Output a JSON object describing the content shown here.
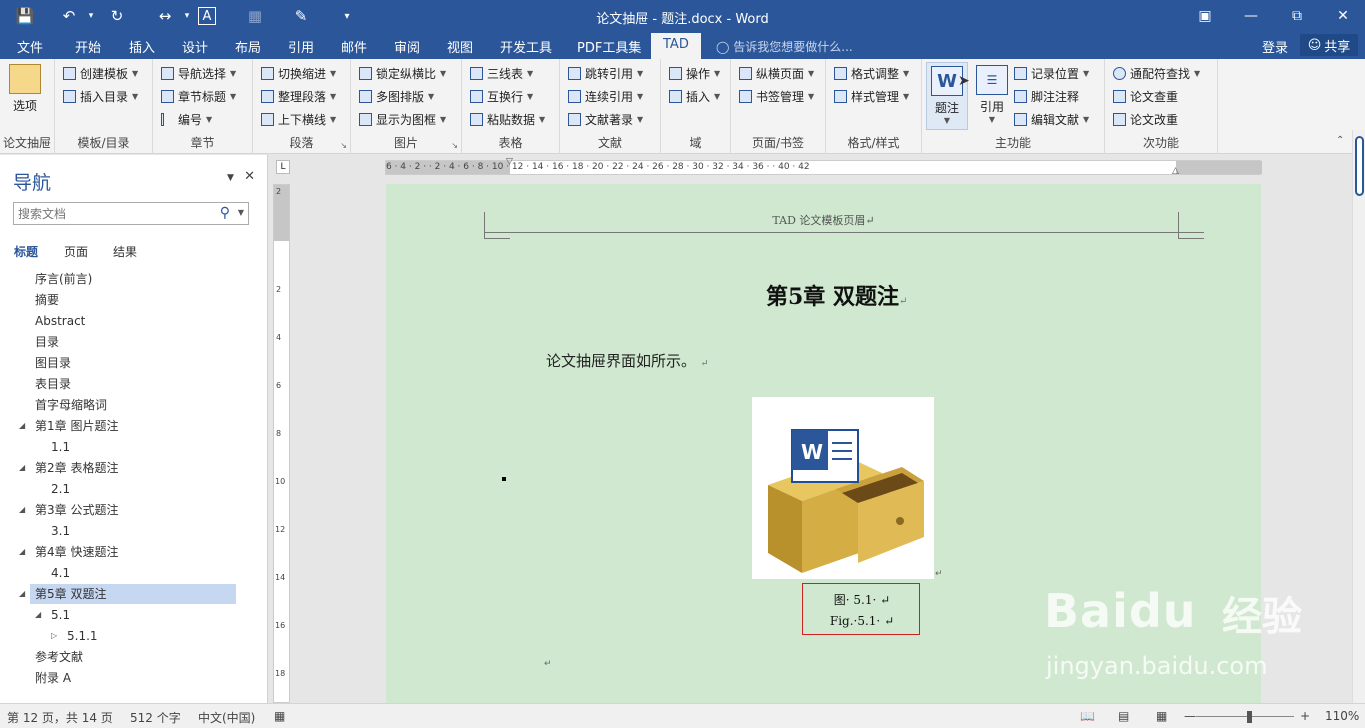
{
  "window": {
    "title": "论文抽屉 - 题注.docx - Word",
    "controls": [
      "restore-ribbon",
      "minimize",
      "restore",
      "close"
    ]
  },
  "tabs": [
    {
      "label": "文件"
    },
    {
      "label": "开始"
    },
    {
      "label": "插入"
    },
    {
      "label": "设计"
    },
    {
      "label": "布局"
    },
    {
      "label": "引用"
    },
    {
      "label": "邮件"
    },
    {
      "label": "审阅"
    },
    {
      "label": "视图"
    },
    {
      "label": "开发工具"
    },
    {
      "label": "PDF工具集"
    },
    {
      "label": "TAD"
    }
  ],
  "tell_me": "告诉我您想要做什么...",
  "account": {
    "login": "登录",
    "share": "共享"
  },
  "ribbon": {
    "groups": {
      "g1": {
        "label": "论文抽屉",
        "big": "选项"
      },
      "g2": {
        "label": "模板/目录",
        "items": [
          "创建模板",
          "插入目录"
        ]
      },
      "g3": {
        "label": "章节",
        "items": [
          "导航选择",
          "章节标题",
          "编号"
        ]
      },
      "g4": {
        "label": "段落",
        "items": [
          "切换缩进",
          "整理段落",
          "上下横线"
        ]
      },
      "g5": {
        "label": "图片",
        "items": [
          "锁定纵横比",
          "多图排版",
          "显示为图框"
        ]
      },
      "g6": {
        "label": "表格",
        "items": [
          "三线表",
          "互换行",
          "粘贴数据"
        ]
      },
      "g7": {
        "label": "文献",
        "items": [
          "跳转引用",
          "连续引用",
          "文献著录"
        ]
      },
      "g8": {
        "label": "域",
        "items": [
          "操作",
          "插入"
        ]
      },
      "g9": {
        "label": "页面/书签",
        "items": [
          "纵横页面",
          "书签管理"
        ]
      },
      "g10": {
        "label": "格式/样式",
        "items": [
          "格式调整",
          "样式管理"
        ]
      },
      "g11": {
        "label": "主功能",
        "big1": "题注",
        "big2": "引用",
        "items": [
          "记录位置",
          "脚注注释",
          "编辑文献"
        ]
      },
      "g12": {
        "label": "次功能",
        "items": [
          "通配符查找",
          "论文查重",
          "论文改重"
        ]
      }
    }
  },
  "nav": {
    "title": "导航",
    "search_placeholder": "搜索文档",
    "tabs": [
      "标题",
      "页面",
      "结果"
    ],
    "items": [
      {
        "label": "序言(前言)"
      },
      {
        "label": "摘要"
      },
      {
        "label": "Abstract"
      },
      {
        "label": "目录"
      },
      {
        "label": "图目录"
      },
      {
        "label": "表目录"
      },
      {
        "label": "首字母缩略词"
      },
      {
        "label": "第1章 图片题注"
      },
      {
        "label": "1.1"
      },
      {
        "label": "第2章 表格题注"
      },
      {
        "label": "2.1"
      },
      {
        "label": "第3章 公式题注"
      },
      {
        "label": "3.1"
      },
      {
        "label": "第4章 快速题注"
      },
      {
        "label": "4.1"
      },
      {
        "label": "第5章 双题注"
      },
      {
        "label": "5.1"
      },
      {
        "label": "5.1.1"
      },
      {
        "label": "参考文献"
      },
      {
        "label": "附录 A"
      }
    ]
  },
  "ruler": {
    "h_marks": "6 · 4 · 2 · · 2 · 4 · 6 · 8 · 10 · 12 · 14 · 16 · 18 · 20 · 22 · 24 · 26 · 28 · 30 · 32 · 34 · 36 · · 40 · 42",
    "v_marks": [
      "2",
      "2",
      "4",
      "6",
      "8",
      "10",
      "12",
      "14",
      "16",
      "18"
    ]
  },
  "document": {
    "header": "TAD 论文模板页眉↵",
    "chapter_title": "第5章 双题注",
    "body": "论文抽屉界面如所示。",
    "paragraph_mark": "↵",
    "caption_cn": "图· 5.1· ↵",
    "caption_en": "Fig.·5.1· ↵",
    "figure_label": "W"
  },
  "status": {
    "page": "第 12 页，共 14 页",
    "words": "512 个字",
    "lang": "中文(中国)",
    "zoom": "110%",
    "zoom_level_percent": 110
  },
  "watermark": {
    "brand": "Baidu",
    "cn": "经验",
    "url": "jingyan.baidu.com"
  },
  "colors": {
    "accent": "#2b579a",
    "page_bg": "#cfe8cf",
    "caption_border": "#cc2222",
    "selected_nav": "#c5d7f1"
  }
}
